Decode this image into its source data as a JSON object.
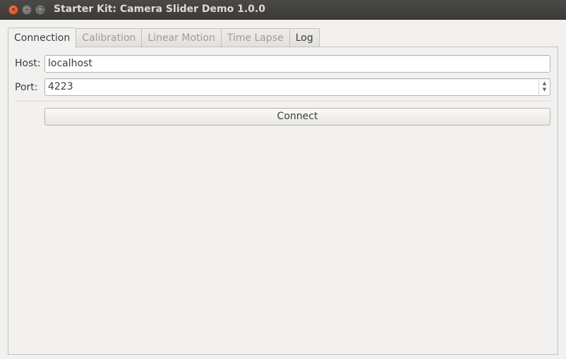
{
  "window": {
    "title": "Starter Kit: Camera Slider Demo 1.0.0",
    "close_glyph": "×",
    "minimize_glyph": "–",
    "maximize_glyph": "□"
  },
  "tabs": [
    {
      "label": "Connection",
      "state": "active"
    },
    {
      "label": "Calibration",
      "state": "disabled"
    },
    {
      "label": "Linear Motion",
      "state": "disabled"
    },
    {
      "label": "Time Lapse",
      "state": "disabled"
    },
    {
      "label": "Log",
      "state": "enabled"
    }
  ],
  "connection": {
    "host_label": "Host:",
    "host_value": "localhost",
    "port_label": "Port:",
    "port_value": "4223",
    "spin_up": "▲",
    "spin_down": "▼",
    "connect_label": "Connect"
  }
}
